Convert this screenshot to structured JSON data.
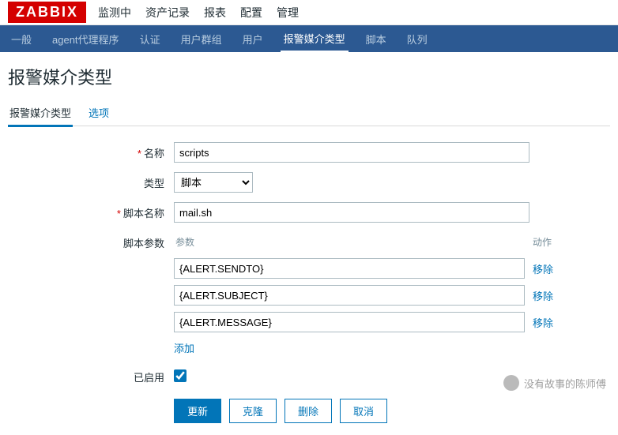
{
  "logo": "ZABBIX",
  "top_nav": [
    "监测中",
    "资产记录",
    "报表",
    "配置",
    "管理"
  ],
  "sub_nav": [
    "一般",
    "agent代理程序",
    "认证",
    "用户群组",
    "用户",
    "报警媒介类型",
    "脚本",
    "队列"
  ],
  "sub_nav_active": 5,
  "page_title": "报警媒介类型",
  "tabs": [
    "报警媒介类型",
    "选项"
  ],
  "tabs_active": 0,
  "labels": {
    "name": "名称",
    "type": "类型",
    "script_name": "脚本名称",
    "script_params": "脚本参数",
    "enabled": "已启用"
  },
  "fields": {
    "name": "scripts",
    "type": "脚本",
    "script_name": "mail.sh",
    "enabled": true
  },
  "params_head": {
    "col1": "参数",
    "col2": "动作"
  },
  "params": [
    {
      "value": "{ALERT.SENDTO}"
    },
    {
      "value": "{ALERT.SUBJECT}"
    },
    {
      "value": "{ALERT.MESSAGE}"
    }
  ],
  "actions": {
    "remove": "移除",
    "add": "添加"
  },
  "buttons": {
    "update": "更新",
    "clone": "克隆",
    "delete": "删除",
    "cancel": "取消"
  },
  "watermark": "没有故事的陈师傅"
}
